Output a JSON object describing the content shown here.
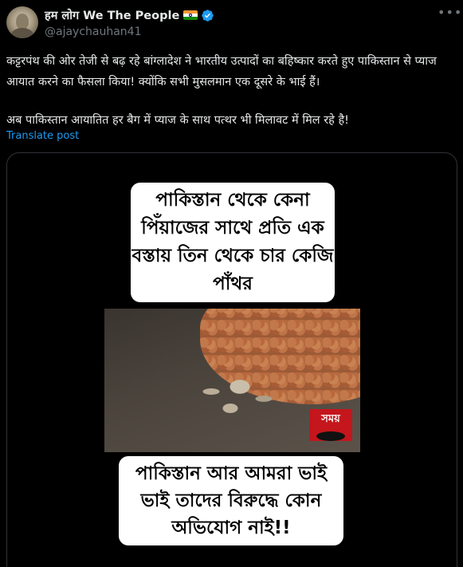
{
  "author": {
    "display_name": "हम लोग We The People",
    "handle": "@ajaychauhan41",
    "flag_icon": "india-flag-icon",
    "verified_icon": "verified-badge-icon",
    "verified_color": "#1d9bf0"
  },
  "more_icon": "more-options-icon",
  "tweet": {
    "paragraph_1": "कट्टरपंथ की ओर तेजी से बढ़ रहे बांग्लादेश ने भारतीय उत्पादों का बहिष्कार करते हुए पाकिस्तान से प्याज आयात करने का फैसला किया! क्योंकि सभी मुसलमान एक दूसरे के भाई हैं।",
    "paragraph_2": "अब पाकिस्तान आयातित हर बैग में प्याज के साथ पत्थर भी मिलावट में मिल रहे है!",
    "translate_label": "Translate post"
  },
  "media": {
    "caption_top": "পাকিস্তান থেকে কেনা পিঁয়াজের সাথে প্রতি এক বস্তায় তিন থেকে চার কেজি পাঁথর",
    "caption_bottom": "পাকিস্তান আর আমরা ভাই ভাই তাদের বিরুদ্ধে কোন অভিযোগ নাই!!",
    "channel_logo_text": "সময়"
  }
}
